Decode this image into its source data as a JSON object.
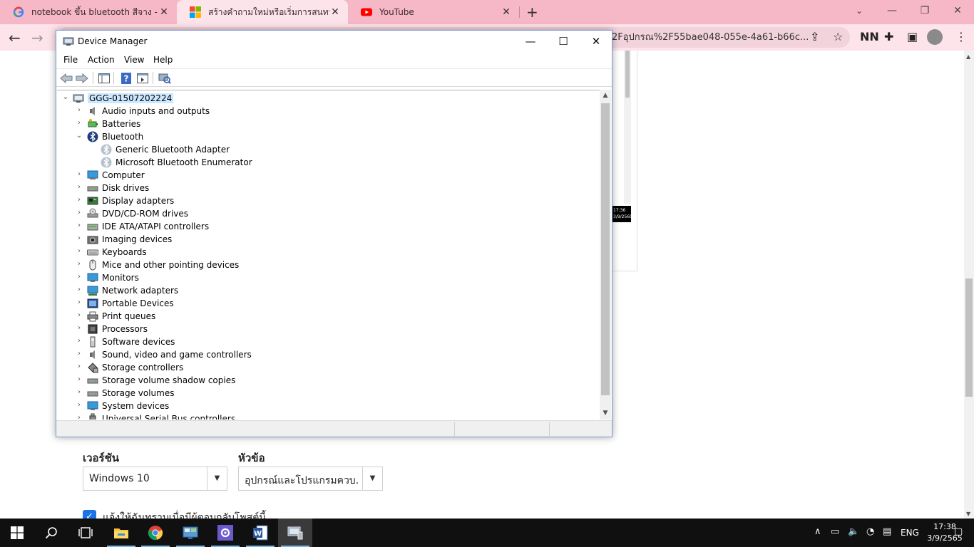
{
  "browser": {
    "tabs": [
      {
        "title": "notebook ขึ้น bluetooth สีจาง - ค้น",
        "icon": "google-icon"
      },
      {
        "title": "สร้างคำถามใหม่หรือเริ่มการสนทนา",
        "icon": "microsoft-icon"
      },
      {
        "title": "YouTube",
        "icon": "youtube-icon"
      }
    ],
    "url_fragment": "2Fอุปกรณ%2F55bae048-055e-4a61-b66c...",
    "accent_color": "#f6b7c6"
  },
  "page": {
    "clock_thumb": [
      "17:36",
      "3/9/2565"
    ],
    "stray_char": "J",
    "version_label": "เวอร์ชัน",
    "version_value": "Windows 10",
    "topic_label": "หัวข้อ",
    "topic_value": "อุปกรณ์และโปรแกรมควบ...",
    "notify_text": "แจ้งให้ฉันทราบเมื่อมีผู้ตอบกลับโพสต์นี้",
    "notify_checked": true
  },
  "device_manager": {
    "title": "Device Manager",
    "menus": [
      "File",
      "Action",
      "View",
      "Help"
    ],
    "root": "GGG-01507202224",
    "categories": [
      {
        "label": "Audio inputs and outputs",
        "icon": "speaker-icon"
      },
      {
        "label": "Batteries",
        "icon": "battery-icon"
      },
      {
        "label": "Bluetooth",
        "icon": "bluetooth-icon",
        "expanded": true
      },
      {
        "label": "Generic Bluetooth Adapter",
        "icon": "bluetooth-device-icon",
        "child": true
      },
      {
        "label": "Microsoft Bluetooth Enumerator",
        "icon": "bluetooth-device-icon",
        "child": true
      },
      {
        "label": "Computer",
        "icon": "computer-icon"
      },
      {
        "label": "Disk drives",
        "icon": "disk-drive-icon"
      },
      {
        "label": "Display adapters",
        "icon": "display-adapter-icon"
      },
      {
        "label": "DVD/CD-ROM drives",
        "icon": "dvd-icon"
      },
      {
        "label": "IDE ATA/ATAPI controllers",
        "icon": "ide-controller-icon"
      },
      {
        "label": "Imaging devices",
        "icon": "camera-icon"
      },
      {
        "label": "Keyboards",
        "icon": "keyboard-icon"
      },
      {
        "label": "Mice and other pointing devices",
        "icon": "mouse-icon"
      },
      {
        "label": "Monitors",
        "icon": "monitor-icon"
      },
      {
        "label": "Network adapters",
        "icon": "network-adapter-icon"
      },
      {
        "label": "Portable Devices",
        "icon": "portable-device-icon"
      },
      {
        "label": "Print queues",
        "icon": "printer-icon"
      },
      {
        "label": "Processors",
        "icon": "processor-icon"
      },
      {
        "label": "Software devices",
        "icon": "software-device-icon"
      },
      {
        "label": "Sound, video and game controllers",
        "icon": "speaker-icon"
      },
      {
        "label": "Storage controllers",
        "icon": "storage-controller-icon"
      },
      {
        "label": "Storage volume shadow copies",
        "icon": "disk-drive-icon"
      },
      {
        "label": "Storage volumes",
        "icon": "disk-drive-icon"
      },
      {
        "label": "System devices",
        "icon": "monitor-icon"
      },
      {
        "label": "Universal Serial Bus controllers",
        "icon": "usb-icon"
      }
    ]
  },
  "taskbar": {
    "apps": [
      "start-icon",
      "search-icon",
      "task-view-icon",
      "file-explorer-icon",
      "chrome-icon",
      "control-panel-icon",
      "settings-icon",
      "word-icon",
      "device-manager-icon"
    ],
    "language": "ENG",
    "time": "17:38",
    "date": "3/9/2565"
  }
}
